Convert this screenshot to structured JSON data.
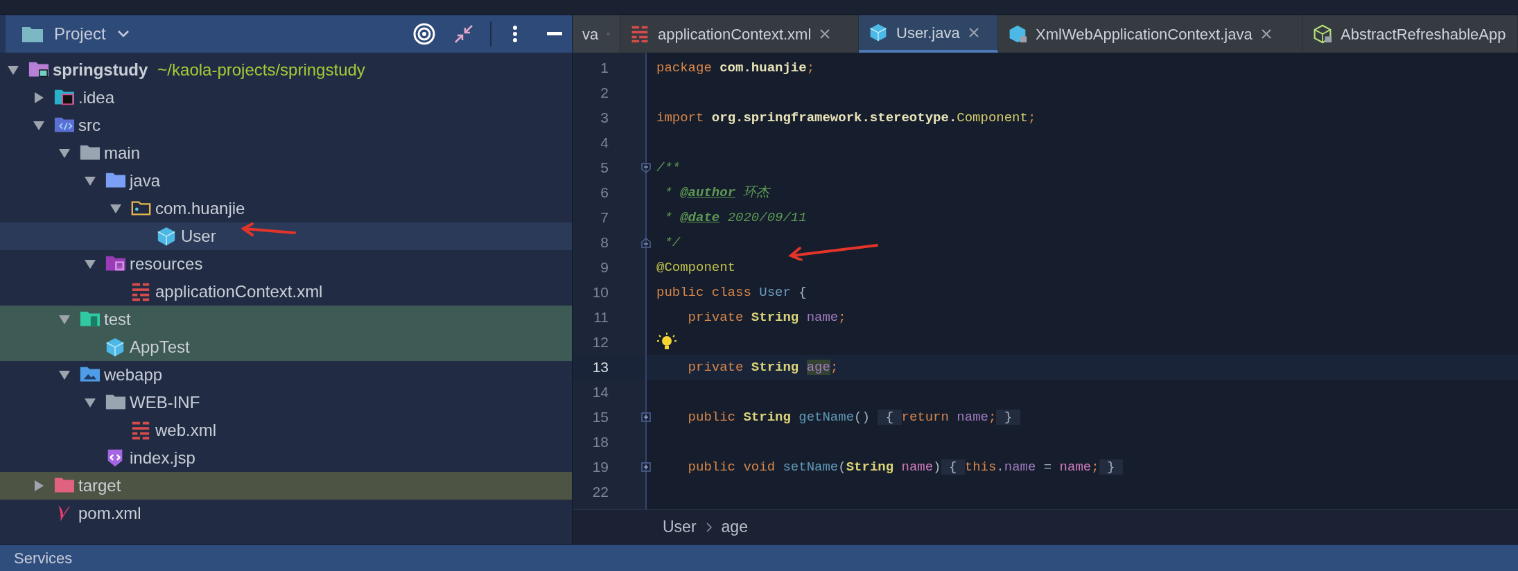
{
  "project_panel": {
    "title": "Project",
    "tree": [
      {
        "label": "springstudy",
        "hint": "~/kaola-projects/springstudy",
        "kind": "module",
        "expanded": true,
        "selected": false,
        "test_scope": false,
        "excluded": false,
        "children": [
          {
            "label": ".idea",
            "kind": "idea",
            "expanded": false,
            "selected": false,
            "test_scope": false,
            "excluded": false
          },
          {
            "label": "src",
            "kind": "src",
            "expanded": true,
            "selected": false,
            "test_scope": false,
            "excluded": false,
            "children": [
              {
                "label": "main",
                "kind": "folder",
                "expanded": true,
                "selected": false,
                "test_scope": false,
                "excluded": false,
                "children": [
                  {
                    "label": "java",
                    "kind": "java",
                    "expanded": true,
                    "selected": false,
                    "test_scope": false,
                    "excluded": false,
                    "children": [
                      {
                        "label": "com.huanjie",
                        "kind": "package",
                        "expanded": true,
                        "selected": false,
                        "test_scope": false,
                        "excluded": false,
                        "children": [
                          {
                            "label": "User",
                            "kind": "class",
                            "selected": true,
                            "test_scope": false,
                            "excluded": false
                          }
                        ]
                      }
                    ]
                  },
                  {
                    "label": "resources",
                    "kind": "resources",
                    "expanded": true,
                    "selected": false,
                    "test_scope": false,
                    "excluded": false,
                    "children": [
                      {
                        "label": "applicationContext.xml",
                        "kind": "xml",
                        "selected": false,
                        "test_scope": false,
                        "excluded": false
                      }
                    ]
                  }
                ]
              },
              {
                "label": "test",
                "kind": "test",
                "expanded": true,
                "selected": false,
                "test_scope": true,
                "excluded": false,
                "children": [
                  {
                    "label": "AppTest",
                    "kind": "class",
                    "selected": false,
                    "test_scope": true,
                    "excluded": false
                  }
                ]
              },
              {
                "label": "webapp",
                "kind": "webapp",
                "expanded": true,
                "selected": false,
                "test_scope": false,
                "excluded": false,
                "children": [
                  {
                    "label": "WEB-INF",
                    "kind": "folder",
                    "expanded": true,
                    "selected": false,
                    "test_scope": false,
                    "excluded": false,
                    "children": [
                      {
                        "label": "web.xml",
                        "kind": "xml",
                        "selected": false,
                        "test_scope": false,
                        "excluded": false
                      }
                    ]
                  },
                  {
                    "label": "index.jsp",
                    "kind": "jsp",
                    "selected": false,
                    "test_scope": false,
                    "excluded": false
                  }
                ]
              }
            ]
          },
          {
            "label": "target",
            "kind": "excluded",
            "expanded": false,
            "selected": false,
            "test_scope": false,
            "excluded": true
          },
          {
            "label": "pom.xml",
            "kind": "maven",
            "selected": false,
            "test_scope": false,
            "excluded": false
          }
        ]
      }
    ]
  },
  "editor_tabs": [
    {
      "label": "va",
      "kind": "none",
      "selected": false,
      "closable": true
    },
    {
      "label": "applicationContext.xml",
      "kind": "xml",
      "selected": false,
      "closable": true
    },
    {
      "label": "User.java",
      "kind": "class",
      "selected": true,
      "closable": true
    },
    {
      "label": "XmlWebApplicationContext.java",
      "kind": "locked-class",
      "selected": false,
      "closable": true
    },
    {
      "label": "AbstractRefreshableApp",
      "kind": "locked-interface",
      "selected": false,
      "closable": false
    }
  ],
  "code_lines": [
    {
      "number": "1",
      "current": false,
      "tokens": [
        {
          "t": "package ",
          "kind": "keyword"
        },
        {
          "t": "com.huanjie",
          "kind": "ident"
        },
        {
          "t": ";",
          "kind": "keyword"
        }
      ]
    },
    {
      "number": "2",
      "current": false
    },
    {
      "number": "3",
      "current": false,
      "tokens": [
        {
          "t": "import ",
          "kind": "keyword"
        },
        {
          "t": "org.springframework.stereotype.",
          "kind": "ident"
        },
        {
          "t": "Component",
          "kind": "type_ref"
        },
        {
          "t": ";",
          "kind": "keyword"
        }
      ]
    },
    {
      "number": "4",
      "current": false
    },
    {
      "number": "5",
      "current": false,
      "marker": {
        "kind": "fold_open"
      },
      "tokens": [
        {
          "t": "/**",
          "kind": "comment"
        }
      ]
    },
    {
      "number": "6",
      "current": false,
      "tokens": [
        {
          "t": " * ",
          "kind": "comment"
        },
        {
          "t": "@author",
          "kind": "doc_tag"
        },
        {
          "t": " 环杰",
          "kind": "comment"
        }
      ]
    },
    {
      "number": "7",
      "current": false,
      "tokens": [
        {
          "t": " * ",
          "kind": "comment"
        },
        {
          "t": "@date",
          "kind": "doc_tag"
        },
        {
          "t": " 2020/09/11",
          "kind": "comment"
        }
      ]
    },
    {
      "number": "8",
      "current": false,
      "marker": {
        "kind": "fold_close"
      },
      "tokens": [
        {
          "t": " */",
          "kind": "comment"
        }
      ]
    },
    {
      "number": "9",
      "current": false,
      "tokens": [
        {
          "t": "@Component",
          "kind": "annotation"
        }
      ]
    },
    {
      "number": "10",
      "current": false,
      "tokens": [
        {
          "t": "public class ",
          "kind": "keyword"
        },
        {
          "t": "User",
          "kind": "class_name"
        },
        {
          "t": " {",
          "kind": "plain"
        }
      ]
    },
    {
      "number": "11",
      "current": false,
      "tokens": [
        {
          "t": "    private ",
          "kind": "keyword"
        },
        {
          "t": "String ",
          "kind": "type"
        },
        {
          "t": "name",
          "kind": "field"
        },
        {
          "t": ";",
          "kind": "keyword"
        }
      ]
    },
    {
      "number": "12",
      "current": false,
      "marker": {
        "kind": "bulb"
      }
    },
    {
      "number": "13",
      "current": true,
      "tokens": [
        {
          "t": "    private ",
          "kind": "keyword"
        },
        {
          "t": "String ",
          "kind": "type"
        },
        {
          "t": "age",
          "kind": "field",
          "highlight": true
        },
        {
          "t": ";",
          "kind": "keyword"
        }
      ]
    },
    {
      "number": "14",
      "current": false
    },
    {
      "number": "15",
      "current": false,
      "marker": {
        "kind": "fold_collapsed"
      },
      "tokens": [
        {
          "t": "    public ",
          "kind": "keyword"
        },
        {
          "t": "String ",
          "kind": "type"
        },
        {
          "t": "getName",
          "kind": "method"
        },
        {
          "t": "() ",
          "kind": "plain"
        },
        {
          "t": " { ",
          "kind": "folded"
        },
        {
          "t": "return ",
          "kind": "keyword"
        },
        {
          "t": "name",
          "kind": "field"
        },
        {
          "t": ";",
          "kind": "keyword"
        },
        {
          "t": " } ",
          "kind": "folded"
        }
      ]
    },
    {
      "number": "18",
      "current": false
    },
    {
      "number": "19",
      "current": false,
      "marker": {
        "kind": "fold_collapsed"
      },
      "tokens": [
        {
          "t": "    public void ",
          "kind": "keyword"
        },
        {
          "t": "setName",
          "kind": "method"
        },
        {
          "t": "(",
          "kind": "plain"
        },
        {
          "t": "String ",
          "kind": "type"
        },
        {
          "t": "name",
          "kind": "param"
        },
        {
          "t": ")",
          "kind": "plain"
        },
        {
          "t": " { ",
          "kind": "folded"
        },
        {
          "t": "this",
          "kind": "keyword"
        },
        {
          "t": ".",
          "kind": "plain"
        },
        {
          "t": "name",
          "kind": "field"
        },
        {
          "t": " = ",
          "kind": "plain"
        },
        {
          "t": "name",
          "kind": "param"
        },
        {
          "t": ";",
          "kind": "keyword"
        },
        {
          "t": " } ",
          "kind": "folded"
        }
      ]
    },
    {
      "number": "22",
      "current": false
    }
  ],
  "editor_breadcrumb": [
    "User",
    "age"
  ],
  "bottom_bar": {
    "title": "Services"
  }
}
